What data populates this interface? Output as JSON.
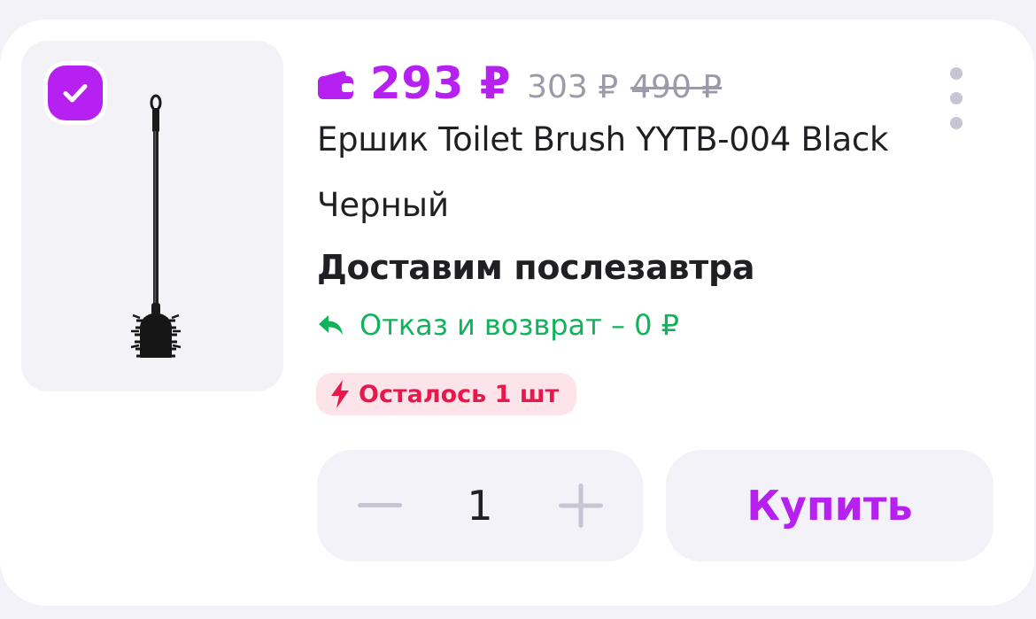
{
  "product": {
    "price_current": "293 ₽",
    "price_card": "303 ₽",
    "price_old": "490 ₽",
    "title": "Ершик Toilet Brush YYTB-004 Black",
    "variant": "Черный",
    "delivery": "Доставим послезавтра",
    "return_policy": "Отказ и возврат – 0 ₽",
    "stock_badge": "Осталось 1 шт",
    "selected": true
  },
  "stepper": {
    "quantity": "1"
  },
  "actions": {
    "buy_label": "Купить"
  },
  "icons": {
    "checkbox": "check-icon",
    "wallet": "wallet-icon",
    "more": "more-vertical-icon",
    "return": "reply-arrow-icon",
    "stock": "lightning-icon",
    "minus": "minus-icon",
    "plus": "plus-icon"
  },
  "colors": {
    "accent": "#b620f0",
    "success": "#11b35a",
    "danger": "#e8184a",
    "danger_bg": "#fde4ea",
    "muted": "#9c9aa8"
  }
}
